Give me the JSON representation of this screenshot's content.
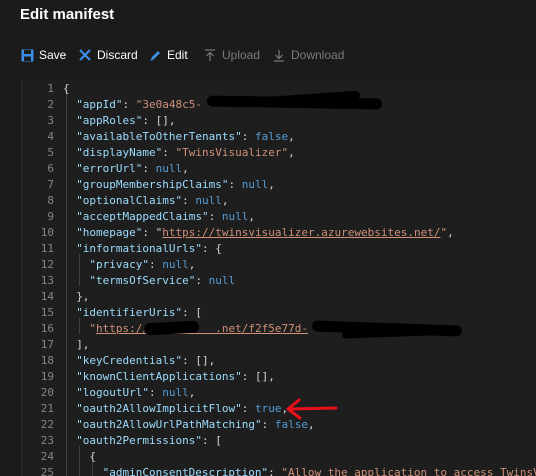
{
  "title": "Edit manifest",
  "toolbar": {
    "save": "Save",
    "discard": "Discard",
    "edit": "Edit",
    "upload": "Upload",
    "download": "Download"
  },
  "editor": {
    "lines": [
      {
        "n": "1",
        "indent": 0,
        "parts": [
          [
            "p",
            "{"
          ]
        ]
      },
      {
        "n": "2",
        "indent": 1,
        "parts": [
          [
            "k",
            "\"appId\""
          ],
          [
            "p",
            ": "
          ],
          [
            "s",
            "\"3e0a48c5-"
          ]
        ]
      },
      {
        "n": "3",
        "indent": 1,
        "parts": [
          [
            "k",
            "\"appRoles\""
          ],
          [
            "p",
            ": [],"
          ]
        ]
      },
      {
        "n": "4",
        "indent": 1,
        "parts": [
          [
            "k",
            "\"availableToOtherTenants\""
          ],
          [
            "p",
            ": "
          ],
          [
            "b",
            "false"
          ],
          [
            "p",
            ","
          ]
        ]
      },
      {
        "n": "5",
        "indent": 1,
        "parts": [
          [
            "k",
            "\"displayName\""
          ],
          [
            "p",
            ": "
          ],
          [
            "s",
            "\"TwinsVisualizer\""
          ],
          [
            "p",
            ","
          ]
        ]
      },
      {
        "n": "6",
        "indent": 1,
        "parts": [
          [
            "k",
            "\"errorUrl\""
          ],
          [
            "p",
            ": "
          ],
          [
            "b",
            "null"
          ],
          [
            "p",
            ","
          ]
        ]
      },
      {
        "n": "7",
        "indent": 1,
        "parts": [
          [
            "k",
            "\"groupMembershipClaims\""
          ],
          [
            "p",
            ": "
          ],
          [
            "b",
            "null"
          ],
          [
            "p",
            ","
          ]
        ]
      },
      {
        "n": "8",
        "indent": 1,
        "parts": [
          [
            "k",
            "\"optionalClaims\""
          ],
          [
            "p",
            ": "
          ],
          [
            "b",
            "null"
          ],
          [
            "p",
            ","
          ]
        ]
      },
      {
        "n": "9",
        "indent": 1,
        "parts": [
          [
            "k",
            "\"acceptMappedClaims\""
          ],
          [
            "p",
            ": "
          ],
          [
            "b",
            "null"
          ],
          [
            "p",
            ","
          ]
        ]
      },
      {
        "n": "10",
        "indent": 1,
        "parts": [
          [
            "k",
            "\"homepage\""
          ],
          [
            "p",
            ": \""
          ],
          [
            "u",
            "https://twinsvisualizer.azurewebsites.net/"
          ],
          [
            "s",
            "\""
          ],
          [
            "p",
            ","
          ]
        ]
      },
      {
        "n": "11",
        "indent": 1,
        "parts": [
          [
            "k",
            "\"informationalUrls\""
          ],
          [
            "p",
            ": {"
          ]
        ]
      },
      {
        "n": "12",
        "indent": 2,
        "parts": [
          [
            "k",
            "\"privacy\""
          ],
          [
            "p",
            ": "
          ],
          [
            "b",
            "null"
          ],
          [
            "p",
            ","
          ]
        ]
      },
      {
        "n": "13",
        "indent": 2,
        "parts": [
          [
            "k",
            "\"termsOfService\""
          ],
          [
            "p",
            ": "
          ],
          [
            "b",
            "null"
          ]
        ]
      },
      {
        "n": "14",
        "indent": 1,
        "parts": [
          [
            "p",
            "},"
          ]
        ]
      },
      {
        "n": "15",
        "indent": 1,
        "parts": [
          [
            "k",
            "\"identifierUris\""
          ],
          [
            "p",
            ": ["
          ]
        ]
      },
      {
        "n": "16",
        "indent": 2,
        "parts": [
          [
            "s",
            "\""
          ],
          [
            "u",
            "https://          .net/f2f5e77d-"
          ]
        ]
      },
      {
        "n": "17",
        "indent": 1,
        "parts": [
          [
            "p",
            "],"
          ]
        ]
      },
      {
        "n": "18",
        "indent": 1,
        "parts": [
          [
            "k",
            "\"keyCredentials\""
          ],
          [
            "p",
            ": [],"
          ]
        ]
      },
      {
        "n": "19",
        "indent": 1,
        "parts": [
          [
            "k",
            "\"knownClientApplications\""
          ],
          [
            "p",
            ": [],"
          ]
        ]
      },
      {
        "n": "20",
        "indent": 1,
        "parts": [
          [
            "k",
            "\"logoutUrl\""
          ],
          [
            "p",
            ": "
          ],
          [
            "b",
            "null"
          ],
          [
            "p",
            ","
          ]
        ]
      },
      {
        "n": "21",
        "indent": 1,
        "parts": [
          [
            "k",
            "\"oauth2AllowImplicitFlow\""
          ],
          [
            "p",
            ": "
          ],
          [
            "b",
            "true"
          ],
          [
            "p",
            ","
          ]
        ]
      },
      {
        "n": "22",
        "indent": 1,
        "parts": [
          [
            "k",
            "\"oauth2AllowUrlPathMatching\""
          ],
          [
            "p",
            ": "
          ],
          [
            "b",
            "false"
          ],
          [
            "p",
            ","
          ]
        ]
      },
      {
        "n": "23",
        "indent": 1,
        "parts": [
          [
            "k",
            "\"oauth2Permissions\""
          ],
          [
            "p",
            ": ["
          ]
        ]
      },
      {
        "n": "24",
        "indent": 2,
        "parts": [
          [
            "p",
            "{"
          ]
        ]
      },
      {
        "n": "25",
        "indent": 3,
        "parts": [
          [
            "k",
            "\"adminConsentDescription\""
          ],
          [
            "p",
            ": "
          ],
          [
            "s",
            "\"Allow the application to access TwinsVi"
          ]
        ]
      }
    ]
  },
  "icons": {
    "save": "save-icon",
    "discard": "close-icon",
    "edit": "pencil-icon",
    "upload": "upload-icon",
    "download": "download-icon",
    "annotation": "red-arrow"
  }
}
